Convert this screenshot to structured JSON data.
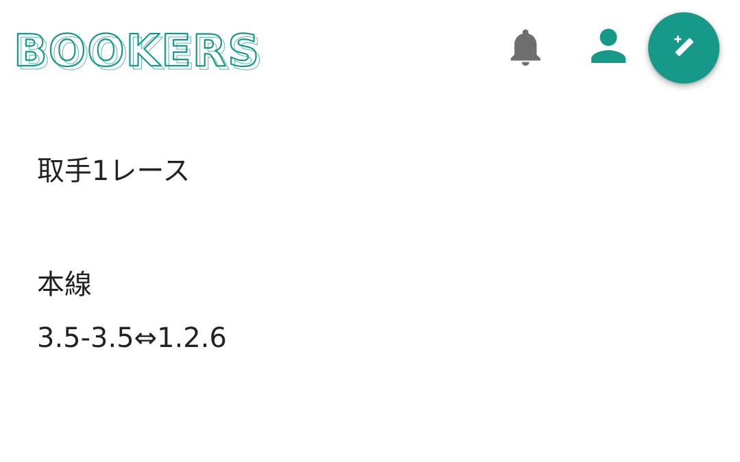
{
  "app": {
    "logo_text": "BOOKERS"
  },
  "header": {
    "notifications_icon": "bell-icon",
    "account_icon": "person-icon",
    "compose_icon": "magic-wand-icon"
  },
  "colors": {
    "brand": "#17998a",
    "icon_gray": "#6e6e6e",
    "text": "#222222",
    "background": "#ffffff"
  },
  "post": {
    "title": "取手1レース",
    "section_label": "本線",
    "bet": "3.5-3.5⇔1.2.6"
  }
}
